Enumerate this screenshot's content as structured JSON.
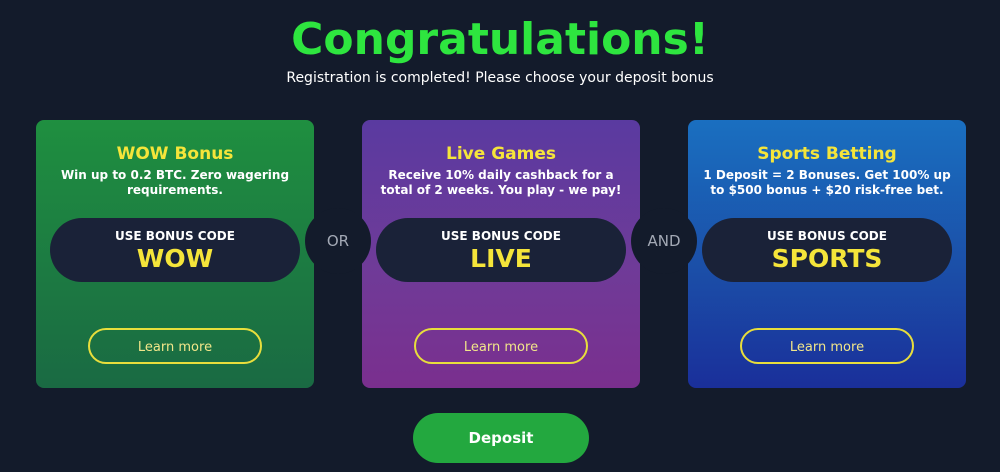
{
  "header": {
    "title": "Congratulations!",
    "subtitle": "Registration is completed! Please choose your deposit bonus"
  },
  "cards": [
    {
      "title": "WOW Bonus",
      "description": "Win up to 0.2 BTC. Zero wagering requirements.",
      "code_label": "USE BONUS CODE",
      "code_value": "WOW",
      "button_label": "Learn more"
    },
    {
      "title": "Live Games",
      "description": "Receive 10% daily cashback for a total of 2 weeks. You play - we pay!",
      "code_label": "USE BONUS CODE",
      "code_value": "LIVE",
      "button_label": "Learn more"
    },
    {
      "title": "Sports Betting",
      "description": "1 Deposit = 2 Bonuses. Get 100% up to $500 bonus + $20 risk-free bet.",
      "code_label": "USE BONUS CODE",
      "code_value": "SPORTS",
      "button_label": "Learn more"
    }
  ],
  "connectors": {
    "first": "OR",
    "second": "AND"
  },
  "footer": {
    "deposit_label": "Deposit"
  },
  "colors": {
    "title_green": "#2ee53f",
    "accent_yellow": "#f5e53a",
    "background": "#131b2b",
    "deposit_green": "#23a83f"
  }
}
